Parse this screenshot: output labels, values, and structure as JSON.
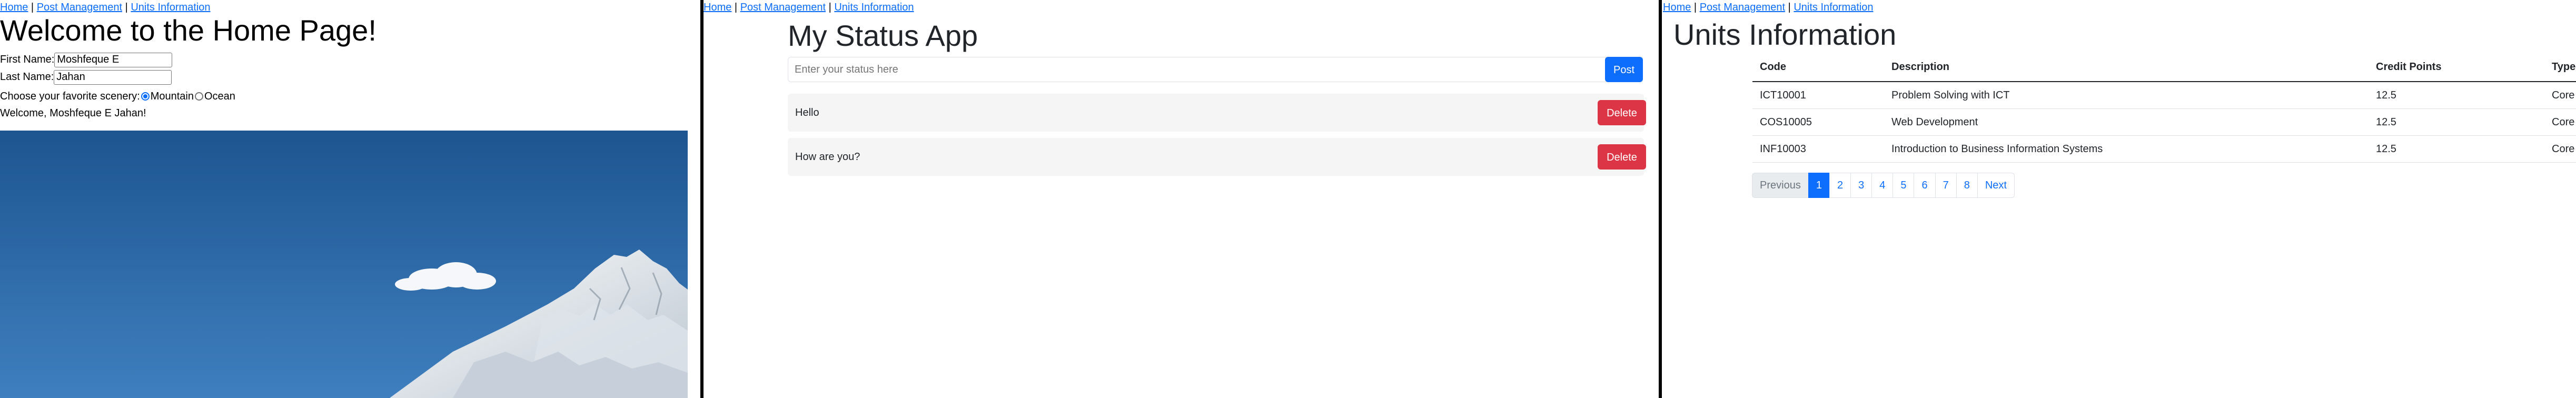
{
  "nav": {
    "home": "Home",
    "sep": "|",
    "posts": "Post Management",
    "units": "Units Information"
  },
  "home": {
    "title": "Welcome to the Home Page!",
    "first_name_label": "First Name:",
    "first_name_value": "Moshfeque E",
    "last_name_label": "Last Name:",
    "last_name_value": "Jahan",
    "scenery_label": "Choose your favorite scenery:",
    "option_mountain": "Mountain",
    "option_ocean": "Ocean",
    "selected_scenery": "Mountain",
    "welcome_message": "Welcome, Moshfeque E Jahan!"
  },
  "status_app": {
    "title": "My Status App",
    "input_placeholder": "Enter your status here",
    "post_label": "Post",
    "statuses": [
      {
        "text": "Hello",
        "delete_label": "Delete"
      },
      {
        "text": "How are you?",
        "delete_label": "Delete"
      }
    ]
  },
  "units": {
    "title": "Units Information",
    "columns": [
      "Code",
      "Description",
      "Credit Points",
      "Type"
    ],
    "rows": [
      [
        "ICT10001",
        "Problem Solving with ICT",
        "12.5",
        "Core"
      ],
      [
        "COS10005",
        "Web Development",
        "12.5",
        "Core"
      ],
      [
        "INF10003",
        "Introduction to Business Information Systems",
        "12.5",
        "Core"
      ]
    ],
    "pagination": {
      "previous": "Previous",
      "pages": [
        "1",
        "2",
        "3",
        "4",
        "5",
        "6",
        "7",
        "8"
      ],
      "active": "1",
      "next": "Next"
    }
  },
  "colors": {
    "primary": "#0d6efd",
    "danger": "#dc3545",
    "sky": "#1f5a93",
    "snow": "#f4f6f8"
  }
}
